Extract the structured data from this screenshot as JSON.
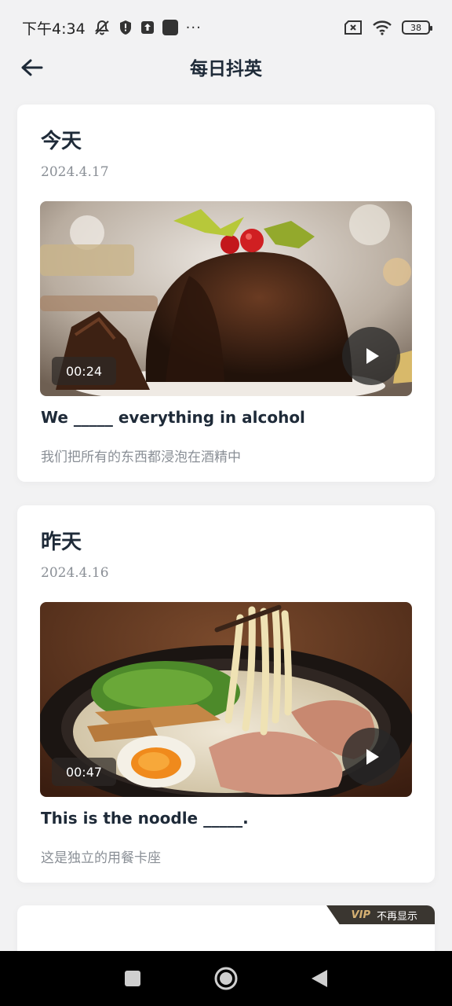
{
  "status_bar": {
    "time": "下午4:34",
    "battery": "38",
    "icons": [
      "mute-bell-icon",
      "shield-icon",
      "upload-icon",
      "app-square-icon",
      "more-dots-icon",
      "sim-x-icon",
      "wifi-icon",
      "battery-icon"
    ],
    "more": "···"
  },
  "header": {
    "title": "每日抖英",
    "back_icon": "arrow-left-icon"
  },
  "cards": [
    {
      "day": "今天",
      "date": "2024.4.17",
      "duration": "00:24",
      "sentence": "We _____ everything in alcohol",
      "translation": "我们把所有的东西都浸泡在酒精中",
      "thumbnail": "christmas-pudding"
    },
    {
      "day": "昨天",
      "date": "2024.4.16",
      "duration": "00:47",
      "sentence": "This is the noodle _____.",
      "translation": "这是独立的用餐卡座",
      "thumbnail": "ramen-bowl"
    }
  ],
  "vip_banner": {
    "vip": "VIP",
    "dismiss": "不再显示"
  },
  "nav": {
    "icons": [
      "recents-square-icon",
      "home-circle-icon",
      "back-triangle-icon"
    ]
  },
  "colors": {
    "background": "#f2f2f3",
    "card": "#ffffff",
    "title": "#1e2a38",
    "muted": "#8a8f96",
    "vip_gold": "#d6b173"
  }
}
